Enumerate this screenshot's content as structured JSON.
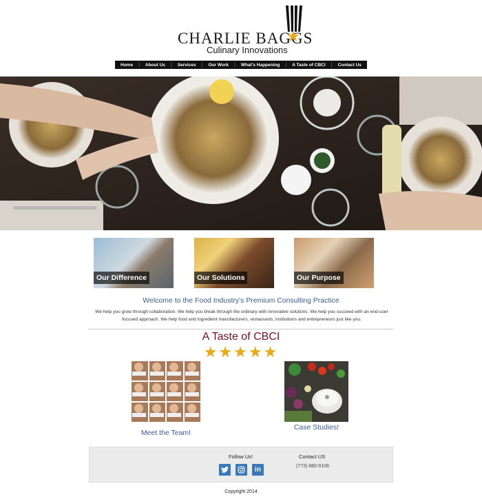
{
  "logo": {
    "name": "CHARLIE BAGGS",
    "tagline": "Culinary Innovations",
    "accent": "#e8a817"
  },
  "nav": {
    "items": [
      "Home",
      "About Us",
      "Services",
      "Our Work",
      "What's Happening",
      "A Taste of CBCI",
      "Contact Us"
    ]
  },
  "tiles": [
    {
      "label": "Our Difference"
    },
    {
      "label": "Our Solutions"
    },
    {
      "label": "Our Purpose"
    }
  ],
  "welcome": {
    "heading": "Welcome to the Food Industry's Premium Consulting Practice",
    "body": "We help you grow through collaboration. We help you break through the ordinary with innovative solutions. We help you succeed with an end-user focused approach. We help food and ingredient manufacturers, restaurants, institutions and entrepreneurs just like you."
  },
  "taste": {
    "title": "A Taste of CBCI",
    "stars": "★★★★★",
    "team_link": "Meet the Team!",
    "cases_link": "Case Studies!"
  },
  "footer": {
    "follow": "Follow Us!",
    "contact": "Contact US",
    "phone": "(773) 880-9108",
    "social_icons": [
      "twitter-icon",
      "instagram-icon",
      "linkedin-icon"
    ],
    "copyright": "Copyright 2014"
  },
  "colors": {
    "link_blue": "#3a5b9a",
    "title_red": "#7a1020",
    "social_blue": "#3a78b8",
    "nav_bg": "#111111"
  }
}
